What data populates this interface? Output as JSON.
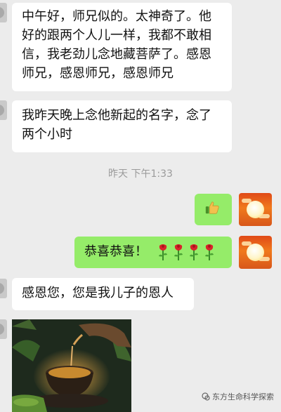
{
  "messages": [
    {
      "side": "left",
      "text": "中午好，师兄似的。太神奇了。他\n好的跟两个人儿一样，我都不敢相\n信，我老劲儿念地藏菩萨了。感恩\n师兄，感恩师兄，感恩师兄"
    },
    {
      "side": "left",
      "text": "我昨天晚上念他新起的名字，念了\n两个小时"
    },
    {
      "side": "right",
      "text": "恭喜恭喜！"
    },
    {
      "side": "left",
      "text": "感恩您，您是我儿子的恩人"
    }
  ],
  "timestamp": "昨天 下午1:33",
  "icons": {
    "thumbs_up": "thumbs-up-emoji",
    "rose": "rose-emoji",
    "rose_count": 4
  },
  "watermark": "东方生命科学探索",
  "colors": {
    "background": "#ececec",
    "sent_bubble": "#95ec69",
    "received_bubble": "#ffffff",
    "timestamp": "#9b9b9b"
  }
}
